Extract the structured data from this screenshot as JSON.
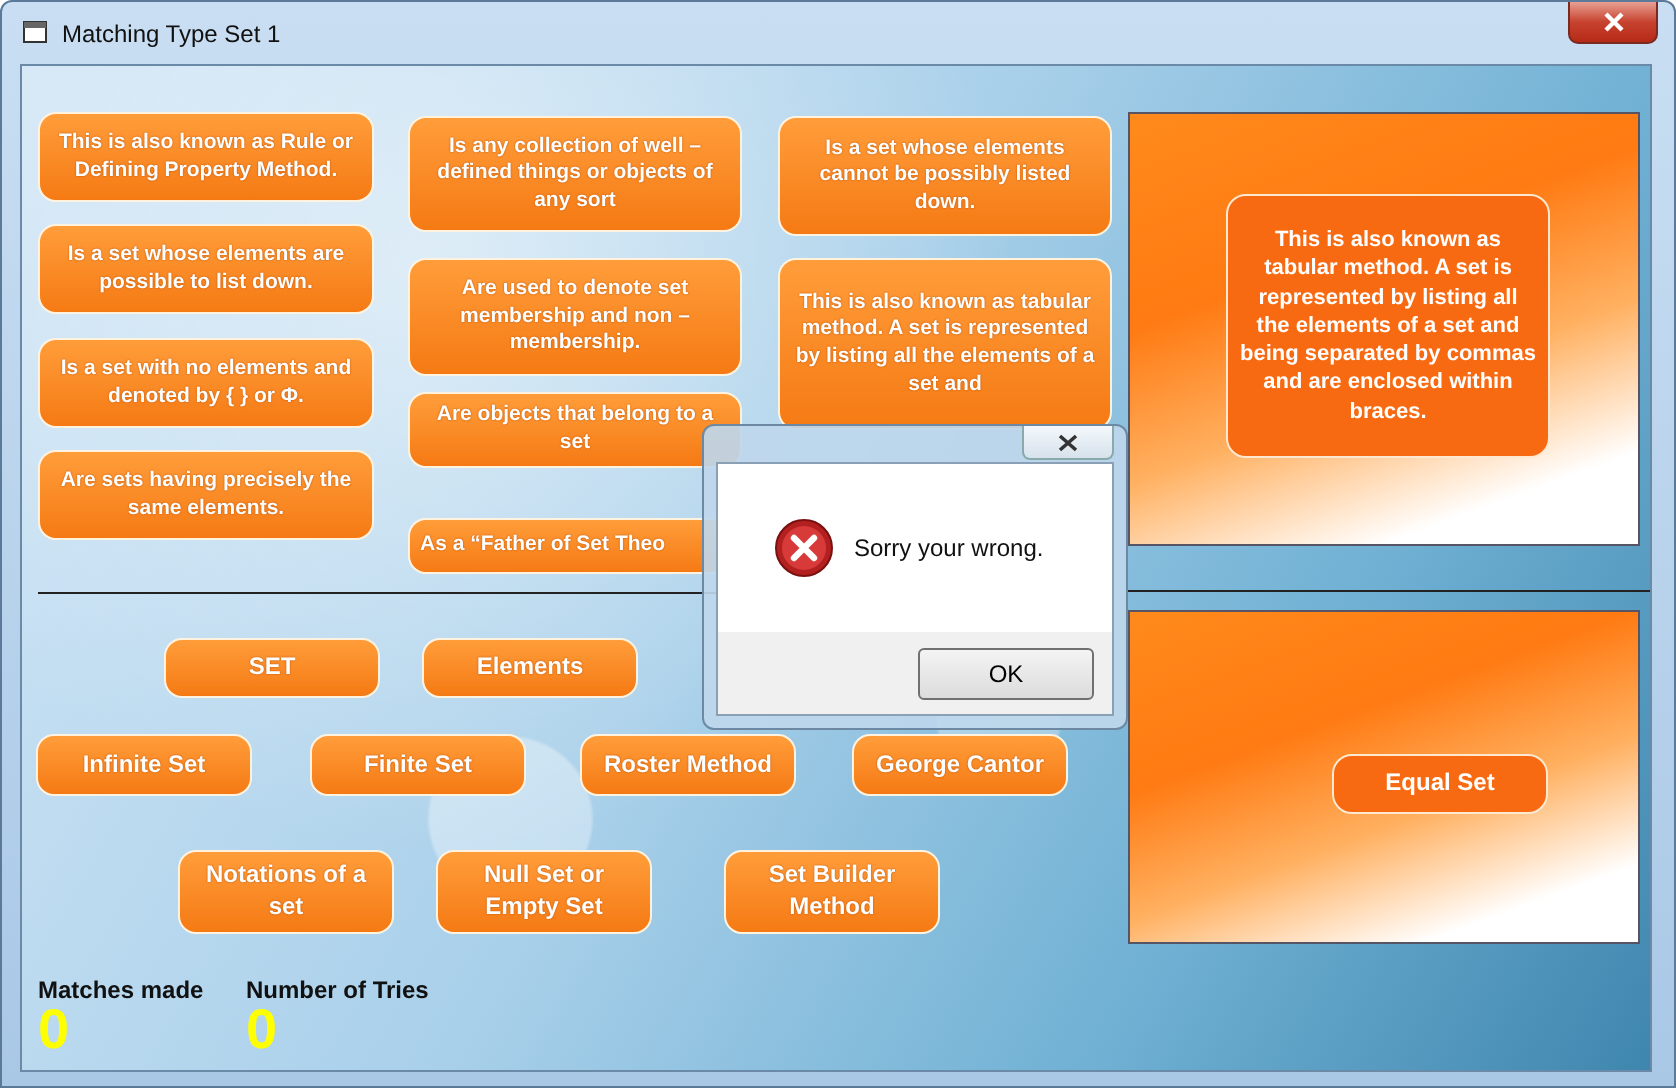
{
  "window": {
    "title": "Matching Type Set 1"
  },
  "clues": [
    {
      "text": "This is also known as Rule or Defining Property Method."
    },
    {
      "text": "Is a set whose elements are possible to list down."
    },
    {
      "text": "Is a set with no elements and denoted by { } or Φ."
    },
    {
      "text": "Are sets having precisely the same elements."
    },
    {
      "text": "Is any collection of well – defined things or objects of any sort"
    },
    {
      "text": "Are used to denote set membership and non – membership."
    },
    {
      "text": "Are objects that belong to a set"
    },
    {
      "text": "As a “Father of Set Theo"
    },
    {
      "text": "Is a set whose elements cannot be possibly listed down."
    },
    {
      "text": "This is also known as tabular method. A set is represented by listing all the elements of a set and"
    }
  ],
  "answers": [
    "SET",
    "Elements",
    "Infinite Set",
    "Finite Set",
    "Roster Method",
    "George Cantor",
    "Notations of a set",
    "Null Set or Empty Set",
    "Set Builder Method"
  ],
  "drop_zones": [
    {
      "text": "This is also known as tabular method. A set is represented by listing all the elements of a set and being separated by commas and are enclosed within braces."
    },
    {
      "text": "Equal Set"
    }
  ],
  "stats": [
    {
      "label": "Matches made",
      "value": "0"
    },
    {
      "label": "Number of Tries",
      "value": "0"
    }
  ],
  "dialog": {
    "message": "Sorry your wrong.",
    "button": "OK"
  }
}
